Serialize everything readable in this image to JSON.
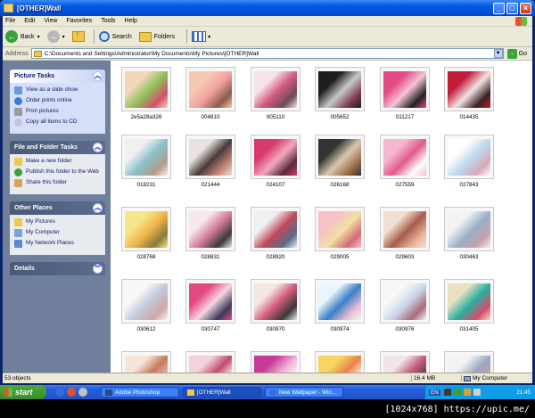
{
  "window": {
    "title": "[OTHER]Wall"
  },
  "menu": [
    "File",
    "Edit",
    "View",
    "Favorites",
    "Tools",
    "Help"
  ],
  "toolbar": {
    "back": "Back",
    "search": "Search",
    "folders": "Folders"
  },
  "address": {
    "label": "Address",
    "path": "C:\\Documents and Settings\\Administrator\\My Documents\\My Pictures\\[OTHER]Wall",
    "go": "Go"
  },
  "taskpane": {
    "picture_tasks": {
      "title": "Picture Tasks",
      "items": [
        "View as a slide show",
        "Order prints online",
        "Print pictures",
        "Copy all items to CD"
      ]
    },
    "file_folder_tasks": {
      "title": "File and Folder Tasks",
      "items": [
        "Make a new folder",
        "Publish this folder to the Web",
        "Share this folder"
      ]
    },
    "other_places": {
      "title": "Other Places",
      "items": [
        "My Pictures",
        "My Computer",
        "My Network Places"
      ]
    },
    "details": {
      "title": "Details"
    }
  },
  "files": [
    {
      "name": "2e5a28a326",
      "colors": [
        "#f3d7b8",
        "#8fbf5a",
        "#d94c6b"
      ]
    },
    {
      "name": "004810",
      "colors": [
        "#f5c9b0",
        "#f3a1a0",
        "#8b5b4a"
      ]
    },
    {
      "name": "005110",
      "colors": [
        "#f7e3ec",
        "#d35a7a",
        "#6b4a5a"
      ]
    },
    {
      "name": "005652",
      "colors": [
        "#1d1d1d",
        "#c9c9c9",
        "#7d3a4c"
      ]
    },
    {
      "name": "011217",
      "colors": [
        "#e24a84",
        "#f4c2d6",
        "#222222"
      ]
    },
    {
      "name": "014435",
      "colors": [
        "#c21e3a",
        "#f2e3e3",
        "#3a2020"
      ]
    },
    {
      "name": "018231",
      "colors": [
        "#f0f0f0",
        "#8ac0c8",
        "#b59a8a"
      ]
    },
    {
      "name": "021444",
      "colors": [
        "#e8e3e0",
        "#4a3a3a",
        "#c98a7a"
      ]
    },
    {
      "name": "024107",
      "colors": [
        "#d83a6a",
        "#f2a7c0",
        "#5a2a3a"
      ]
    },
    {
      "name": "026168",
      "colors": [
        "#333333",
        "#d9c7b0",
        "#9a6a4a"
      ]
    },
    {
      "name": "027559",
      "colors": [
        "#f4b8d0",
        "#e25a8a",
        "#ffffff"
      ]
    },
    {
      "name": "027843",
      "colors": [
        "#ffffff",
        "#bcd7ee",
        "#d8a9b8"
      ]
    },
    {
      "name": "028768",
      "colors": [
        "#f7e58a",
        "#f0b54a",
        "#8a7a3a"
      ]
    },
    {
      "name": "028831",
      "colors": [
        "#f7e7ef",
        "#d47a9a",
        "#3a3a3a"
      ]
    },
    {
      "name": "028920",
      "colors": [
        "#eef0f2",
        "#c14a5a",
        "#5a6a8a"
      ]
    },
    {
      "name": "029005",
      "colors": [
        "#f6c2c8",
        "#f0e0a0",
        "#d46a7a"
      ]
    },
    {
      "name": "029603",
      "colors": [
        "#f1e0d2",
        "#a85a4a",
        "#e9b7a0"
      ]
    },
    {
      "name": "030463",
      "colors": [
        "#f3f3f3",
        "#9ab0c8",
        "#c8a0b0"
      ]
    },
    {
      "name": "030612",
      "colors": [
        "#f7f7f7",
        "#c0c8d8",
        "#d0a8a8"
      ]
    },
    {
      "name": "030747",
      "colors": [
        "#e24a84",
        "#f6d4e2",
        "#3a3a5a"
      ]
    },
    {
      "name": "030970",
      "colors": [
        "#f4e7e2",
        "#d25a7a",
        "#3a3a3a"
      ]
    },
    {
      "name": "030974",
      "colors": [
        "#eaf4fb",
        "#3a80c8",
        "#f0c0d0"
      ]
    },
    {
      "name": "030976",
      "colors": [
        "#f7f7f7",
        "#c8d8e8",
        "#a86a7a"
      ]
    },
    {
      "name": "031405",
      "colors": [
        "#e9e1c2",
        "#2ab0a0",
        "#d84a6a"
      ]
    },
    {
      "name": "",
      "colors": [
        "#f5e6d8",
        "#c87a5a",
        "#e9c2b0"
      ]
    },
    {
      "name": "",
      "colors": [
        "#f4d2dc",
        "#c24a6a",
        "#ffffff"
      ]
    },
    {
      "name": "",
      "colors": [
        "#c83a9a",
        "#f0b0d8",
        "#ffffff"
      ]
    },
    {
      "name": "",
      "colors": [
        "#f6d560",
        "#e9824a",
        "#ffffff"
      ]
    },
    {
      "name": "",
      "colors": [
        "#f3e4ea",
        "#c25a7a",
        "#4a3a4a"
      ]
    },
    {
      "name": "",
      "colors": [
        "#f2f2f2",
        "#9aa8c0",
        "#c8a0b0"
      ]
    }
  ],
  "status": {
    "objects": "53 objects",
    "size": "16.4 MB",
    "location": "My Computer"
  },
  "taskbar": {
    "start": "start",
    "tasks": [
      "Adobe Photoshop",
      "[OTHER]Wall",
      "New Wallpaper - Win..."
    ],
    "lang": "EN",
    "clock": "21:45"
  },
  "watermark": "[1024x768] https://upic.me/"
}
